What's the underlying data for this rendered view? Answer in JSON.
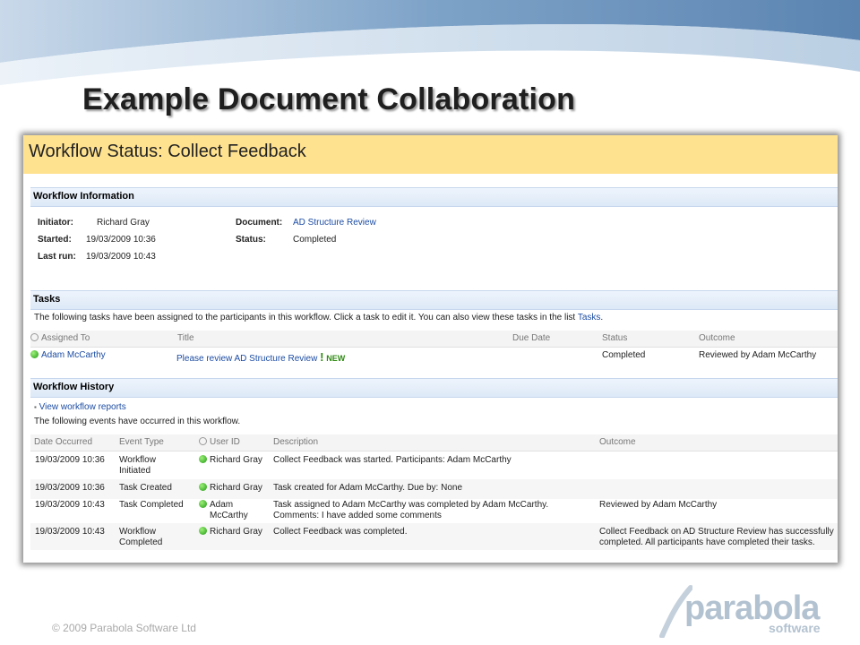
{
  "slide": {
    "title": "Example Document Collaboration",
    "footer": "© 2009 Parabola Software Ltd",
    "logo_main": "parabola",
    "logo_sub": "software"
  },
  "workflow": {
    "page_title": "Workflow Status: Collect Feedback",
    "info_section": "Workflow Information",
    "info": {
      "initiator_label": "Initiator:",
      "initiator": "Richard Gray",
      "started_label": "Started:",
      "started": "19/03/2009 10:36",
      "last_run_label": "Last run:",
      "last_run": "19/03/2009 10:43",
      "document_label": "Document:",
      "document": "AD Structure Review",
      "status_label": "Status:",
      "status": "Completed"
    },
    "tasks_section": "Tasks",
    "tasks_intro": "The following tasks have been assigned to the participants in this workflow. Click a task to edit it. You can also view these tasks in the list",
    "tasks_link": "Tasks",
    "tasks_columns": [
      "Assigned To",
      "Title",
      "Due Date",
      "Status",
      "Outcome"
    ],
    "task_row": {
      "assigned_to": "Adam McCarthy",
      "title": "Please review AD Structure Review",
      "new_badge": "NEW",
      "due_date": "",
      "status": "Completed",
      "outcome": "Reviewed by Adam McCarthy"
    },
    "history_section": "Workflow History",
    "view_reports": "View workflow reports",
    "history_intro": "The following events have occurred in this workflow.",
    "history_columns": [
      "Date Occurred",
      "Event Type",
      "User ID",
      "Description",
      "Outcome"
    ],
    "history": [
      {
        "date": "19/03/2009 10:36",
        "event": "Workflow Initiated",
        "user": "Richard Gray",
        "description": "Collect Feedback was started.  Participants: Adam McCarthy",
        "outcome": ""
      },
      {
        "date": "19/03/2009 10:36",
        "event": "Task Created",
        "user": "Richard Gray",
        "description": "Task created for Adam McCarthy.  Due by: None",
        "outcome": ""
      },
      {
        "date": "19/03/2009 10:43",
        "event": "Task Completed",
        "user": "Adam McCarthy",
        "description": "Task assigned to Adam McCarthy was completed by Adam McCarthy. Comments: I have added some comments",
        "outcome": "Reviewed by Adam McCarthy"
      },
      {
        "date": "19/03/2009 10:43",
        "event": "Workflow Completed",
        "user": "Richard Gray",
        "description": "Collect Feedback was completed.",
        "outcome": "Collect Feedback on AD Structure Review has successfully completed. All participants have completed their tasks."
      }
    ]
  },
  "colors": {
    "header_bg": "#ffe290",
    "link": "#1c4ca3",
    "section_bg": "#dde9f7",
    "presence": "#2fb01c"
  }
}
